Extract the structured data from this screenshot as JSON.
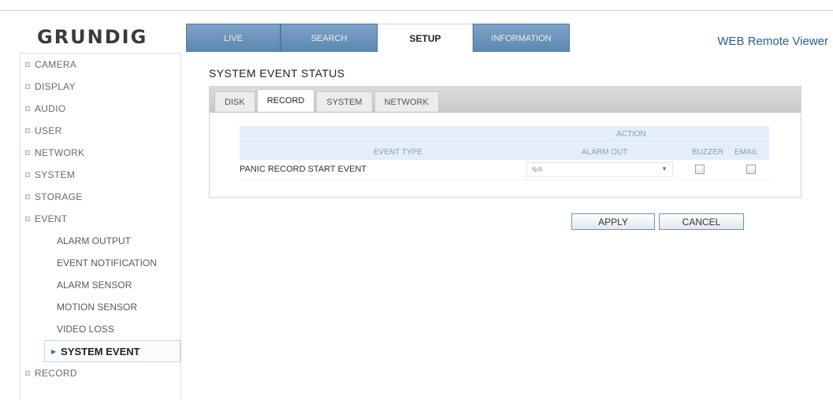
{
  "brand": {
    "logo": "GRUNDIG",
    "viewer_title": "WEB Remote Viewer"
  },
  "tabs": [
    {
      "label": "LIVE"
    },
    {
      "label": "SEARCH"
    },
    {
      "label": "SETUP",
      "active": true
    },
    {
      "label": "INFORMATION"
    }
  ],
  "sidebar": {
    "items": [
      {
        "label": "CAMERA"
      },
      {
        "label": "DISPLAY"
      },
      {
        "label": "AUDIO"
      },
      {
        "label": "USER"
      },
      {
        "label": "NETWORK"
      },
      {
        "label": "SYSTEM"
      },
      {
        "label": "STORAGE"
      },
      {
        "label": "EVENT"
      }
    ],
    "event_sub": [
      {
        "label": "ALARM OUTPUT"
      },
      {
        "label": "EVENT NOTIFICATION"
      },
      {
        "label": "ALARM SENSOR"
      },
      {
        "label": "MOTION SENSOR"
      },
      {
        "label": "VIDEO LOSS"
      },
      {
        "label": "SYSTEM EVENT",
        "active": true
      }
    ],
    "after": [
      {
        "label": "RECORD"
      }
    ]
  },
  "page": {
    "title": "SYSTEM EVENT STATUS"
  },
  "subtabs": [
    {
      "label": "DISK"
    },
    {
      "label": "RECORD",
      "active": true
    },
    {
      "label": "SYSTEM"
    },
    {
      "label": "NETWORK"
    }
  ],
  "table": {
    "group_header": "ACTION",
    "headers": {
      "event_type": "EVENT TYPE",
      "alarm_out": "ALARM OUT",
      "buzzer": "BUZZER",
      "email": "EMAIL"
    },
    "rows": [
      {
        "event": "PANIC RECORD START EVENT",
        "alarm_out": "N/A",
        "buzzer": false,
        "email": false
      }
    ]
  },
  "buttons": {
    "apply": "APPLY",
    "cancel": "CANCEL"
  },
  "colors": {
    "tab_blue": "#5c86b1",
    "header_bg": "#e3eef8",
    "link_blue": "#2b5e8e"
  }
}
